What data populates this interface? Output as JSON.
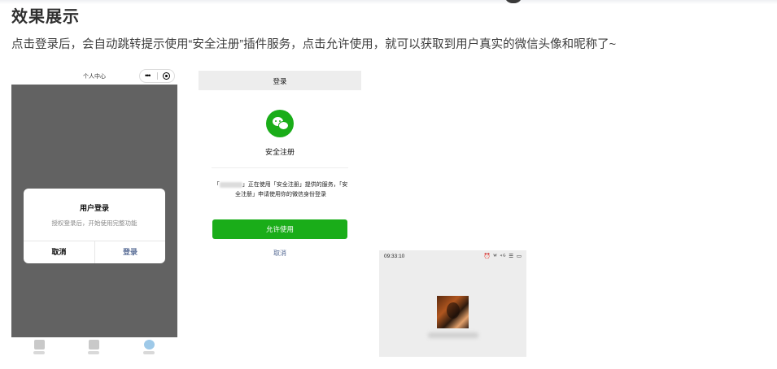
{
  "section": {
    "heading": "效果展示",
    "description": "点击登录后，会自动跳转提示使用“安全注册”插件服务，点击允许使用，就可以获取到用户真实的微信头像和昵称了~"
  },
  "phone1": {
    "nav_title": "个人中心",
    "capsule_more": "•••",
    "modal": {
      "title": "用户登录",
      "message": "授权登录后，开始使用完整功能",
      "cancel_label": "取消",
      "confirm_label": "登录",
      "confirm_color": "#576b95"
    },
    "overlay_color": "#626262"
  },
  "phone2": {
    "nav_title": "登录",
    "app_name": "安全注册",
    "auth_text_prefix": "「",
    "auth_text_rest": "」正在使用「安全注册」提供的服务，「安全注册」申请使用你的微信身份登录",
    "allow_label": "允许使用",
    "cancel_label": "取消",
    "brand_color": "#1aad19"
  },
  "phone3": {
    "status_time": "09:33:10",
    "status_icons": "⏰ ᵂ ⁴ᴳ ☰ ▭"
  }
}
